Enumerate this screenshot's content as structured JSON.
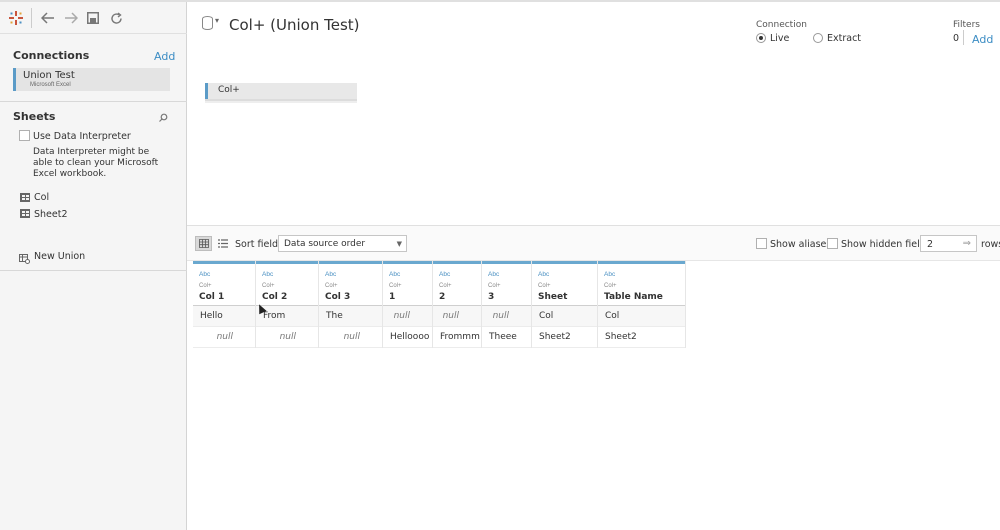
{
  "toolbar": {
    "icons": [
      "tableau-logo-icon",
      "back-arrow-icon",
      "forward-arrow-icon",
      "save-icon",
      "refresh-icon"
    ]
  },
  "sidebar": {
    "connections_title": "Connections",
    "connections_add": "Add",
    "connection": {
      "name": "Union Test",
      "type": "Microsoft Excel"
    },
    "sheets_title": "Sheets",
    "use_data_interpreter": "Use Data Interpreter",
    "data_interpreter_desc": "Data Interpreter might be able to clean your Microsoft Excel workbook.",
    "sheets": [
      "Col",
      "Sheet2"
    ],
    "new_union": "New Union"
  },
  "header": {
    "datasource_title": "Col+ (Union Test)",
    "connection_label": "Connection",
    "live_label": "Live",
    "extract_label": "Extract",
    "connection_selected": "Live",
    "filters_label": "Filters",
    "filters_count": "0",
    "filters_add": "Add"
  },
  "canvas": {
    "table_name": "Col+"
  },
  "grid_toolbar": {
    "sort_label": "Sort fields",
    "sort_value": "Data source order",
    "show_aliases": "Show aliases",
    "show_hidden_fields": "Show hidden fields",
    "rows_value": "2",
    "rows_label": "rows"
  },
  "data_grid": {
    "columns": [
      {
        "type": "Abc",
        "source": "Col+",
        "name": "Col 1"
      },
      {
        "type": "Abc",
        "source": "Col+",
        "name": "Col 2"
      },
      {
        "type": "Abc",
        "source": "Col+",
        "name": "Col 3"
      },
      {
        "type": "Abc",
        "source": "Col+",
        "name": "1"
      },
      {
        "type": "Abc",
        "source": "Col+",
        "name": "2"
      },
      {
        "type": "Abc",
        "source": "Col+",
        "name": "3"
      },
      {
        "type": "Abc",
        "source": "Col+",
        "name": "Sheet"
      },
      {
        "type": "Abc",
        "source": "Col+",
        "name": "Table Name"
      }
    ],
    "rows": [
      [
        "Hello",
        "From",
        "The",
        "null",
        "null",
        "null",
        "Col",
        "Col"
      ],
      [
        "null",
        "null",
        "null",
        "Helloooo",
        "Frommm",
        "Theee",
        "Sheet2",
        "Sheet2"
      ]
    ]
  },
  "colors": {
    "accent": "#5b9bc7",
    "link": "#3c8dc4",
    "header_rule": "#6aa8cf"
  }
}
